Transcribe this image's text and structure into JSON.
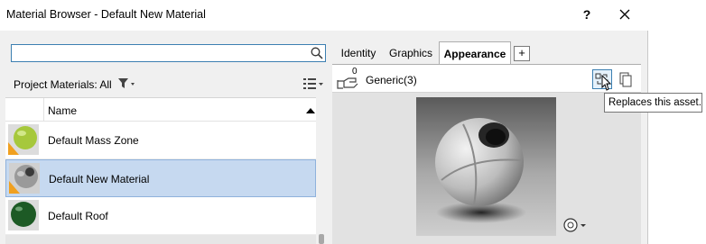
{
  "window": {
    "title": "Material Browser - Default New Material",
    "help_label": "?"
  },
  "search": {
    "value": "",
    "placeholder": ""
  },
  "project_bar": {
    "label": "Project Materials: All"
  },
  "list": {
    "column_header": "Name",
    "rows": [
      {
        "label": "Default Mass Zone",
        "thumb_color": "#a6c83c",
        "selected": false
      },
      {
        "label": "Default New Material",
        "thumb_color": "#9a9a9a",
        "selected": true
      },
      {
        "label": "Default Roof",
        "thumb_color": "#1d5a25",
        "selected": false
      }
    ]
  },
  "tabs": [
    {
      "label": "Identity",
      "active": false
    },
    {
      "label": "Graphics",
      "active": false
    },
    {
      "label": "Appearance",
      "active": true
    }
  ],
  "add_tab_label": "+",
  "asset": {
    "count": "0",
    "name": "Generic(3)"
  },
  "tooltip": {
    "text": "Replaces this asset."
  },
  "colors": {
    "selection_bg": "#c6d9f0",
    "selection_border": "#8fb2dc",
    "focus_border": "#3c7fb1",
    "panel_bg": "#f0f0f0"
  },
  "icons": {
    "search": "search-icon",
    "filter": "filter-icon",
    "view": "view-options-icon",
    "sort": "sort-ascending-icon",
    "hand": "hand-icon",
    "replace": "replace-asset-icon",
    "duplicate": "duplicate-asset-icon",
    "render": "render-options-icon",
    "close": "close-icon"
  }
}
